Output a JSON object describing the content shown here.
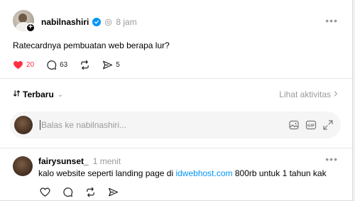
{
  "post": {
    "username": "nabilnashiri",
    "time": "8 jam",
    "text": "Ratecardnya pembuatan web berapa lur?",
    "likes": "20",
    "comments": "63",
    "shares": "5"
  },
  "sort": {
    "label": "Terbaru",
    "activity_link": "Lihat aktivitas"
  },
  "reply": {
    "placeholder": "Balas ke nabilnashiri..."
  },
  "comment": {
    "username": "fairysunset_",
    "time": "1 menit",
    "text_before": "kalo website seperti landing page di ",
    "link": "idwebhost.com",
    "text_after": " 800rb untuk 1 tahun kak"
  },
  "colors": {
    "like": "#ff3040",
    "link": "#0095f6",
    "muted": "#999999"
  },
  "icons": [
    "verified-icon",
    "threads-icon",
    "heart-icon",
    "comment-icon",
    "repost-icon",
    "share-icon",
    "sort-icon",
    "chevron-down-icon",
    "chevron-right-icon",
    "image-icon",
    "gif-icon",
    "expand-icon",
    "more-icon"
  ]
}
